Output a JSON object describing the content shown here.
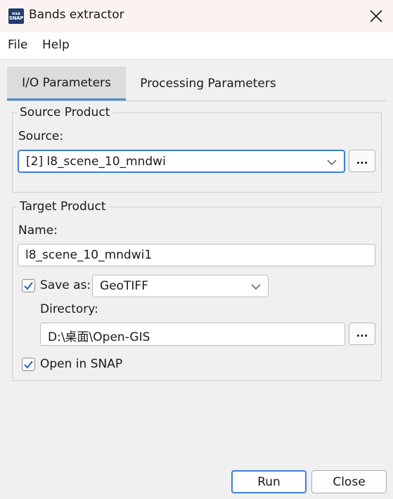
{
  "window": {
    "title": "Bands extractor",
    "icon": {
      "name": "snap-app-icon",
      "top_text": "esa",
      "bottom_text": "SNAP"
    }
  },
  "menu": {
    "items": [
      {
        "label": "File"
      },
      {
        "label": "Help"
      }
    ]
  },
  "tabs": [
    {
      "label": "I/O Parameters",
      "active": true
    },
    {
      "label": "Processing Parameters",
      "active": false
    }
  ],
  "source_product": {
    "legend": "Source Product",
    "source_label": "Source:",
    "source_value": "[2] l8_scene_10_mndwi",
    "browse_label": "..."
  },
  "target_product": {
    "legend": "Target Product",
    "name_label": "Name:",
    "name_value": "l8_scene_10_mndwi1",
    "save_as_label": "Save as:",
    "save_as_checked": true,
    "format_value": "GeoTIFF",
    "directory_label": "Directory:",
    "directory_value": "D:\\桌面\\Open-GIS",
    "browse_label": "...",
    "open_in_snap_label": "Open in SNAP",
    "open_in_snap_checked": true
  },
  "buttons": {
    "run_label": "Run",
    "close_label": "Close"
  },
  "colors": {
    "accent": "#3d7ed6",
    "titlebar_bg": "#fbf3f1",
    "checkbox_tick": "#1f5fbf"
  }
}
